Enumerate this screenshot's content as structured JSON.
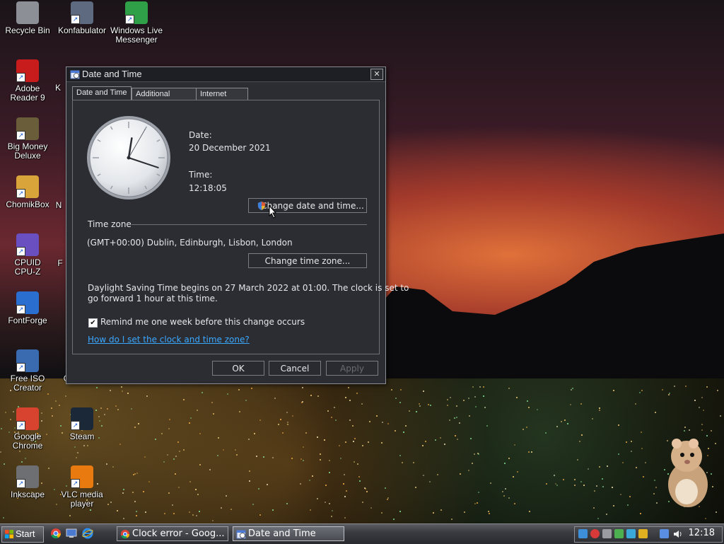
{
  "desktop": {
    "icons": [
      {
        "label1": "Recycle Bin",
        "label2": "",
        "icon": "recycle-bin-icon"
      },
      {
        "label1": "Konfabulator",
        "label2": "",
        "icon": "konfabulator-icon"
      },
      {
        "label1": "Windows Live",
        "label2": "Messenger",
        "icon": "messenger-icon"
      },
      {
        "label1": "Adobe",
        "label2": "Reader 9",
        "icon": "adobe-reader-icon"
      },
      {
        "label1": "Big Money",
        "label2": "Deluxe",
        "icon": "big-money-icon"
      },
      {
        "label1": "ChomikBox",
        "label2": "",
        "icon": "chomikbox-icon"
      },
      {
        "label1": "CPUID",
        "label2": "CPU-Z",
        "icon": "cpuz-icon"
      },
      {
        "label1": "FontForge",
        "label2": "",
        "icon": "fontforge-icon"
      },
      {
        "label1": "Free ISO",
        "label2": "Creator",
        "icon": "free-iso-icon"
      },
      {
        "label1": "Great G...",
        "label2": "",
        "icon": "great-g-icon"
      },
      {
        "label1": "Google",
        "label2": "Chrome",
        "icon": "chrome-icon"
      },
      {
        "label1": "Steam",
        "label2": "",
        "icon": "steam-icon"
      },
      {
        "label1": "Inkscape",
        "label2": "",
        "icon": "inkscape-icon"
      },
      {
        "label1": "VLC media",
        "label2": "player",
        "icon": "vlc-icon"
      }
    ],
    "partial_labels": [
      "K",
      "N",
      "F"
    ]
  },
  "dialog": {
    "title": "Date and Time",
    "close_label": "✕",
    "tabs": [
      {
        "label": "Date and Time",
        "active": true
      },
      {
        "label": "Additional Clocks",
        "active": false
      },
      {
        "label": "Internet Time",
        "active": false
      }
    ],
    "date_label": "Date:",
    "date_value": "20 December 2021",
    "time_label": "Time:",
    "time_value": "12:18:05",
    "change_datetime_button": "Change date and time...",
    "timezone_heading": "Time zone",
    "timezone_value": "(GMT+00:00) Dublin, Edinburgh, Lisbon, London",
    "change_timezone_button": "Change time zone...",
    "dst_line1": "Daylight Saving Time begins on 27 March 2022 at 01:00. The clock is set to",
    "dst_line2": "go forward 1 hour at this time.",
    "remind_checked": true,
    "remind_label": "Remind me one week before this change occurs",
    "help_link": "How do I set the clock and time zone?",
    "ok_button": "OK",
    "cancel_button": "Cancel",
    "apply_button": "Apply",
    "analog_clock": {
      "hour": 12,
      "minute": 18,
      "second": 5
    }
  },
  "taskbar": {
    "start_label": "Start",
    "tasks": [
      {
        "label": "Clock error - Goog...",
        "icon": "chrome-icon",
        "active": false
      },
      {
        "label": "Date and Time",
        "icon": "date-time-icon",
        "active": true
      }
    ],
    "clock": "12:18"
  },
  "colors": {
    "dialog_bg": "#2c2d33",
    "link": "#3aa8ff",
    "taskbar": "#3a3b40"
  }
}
